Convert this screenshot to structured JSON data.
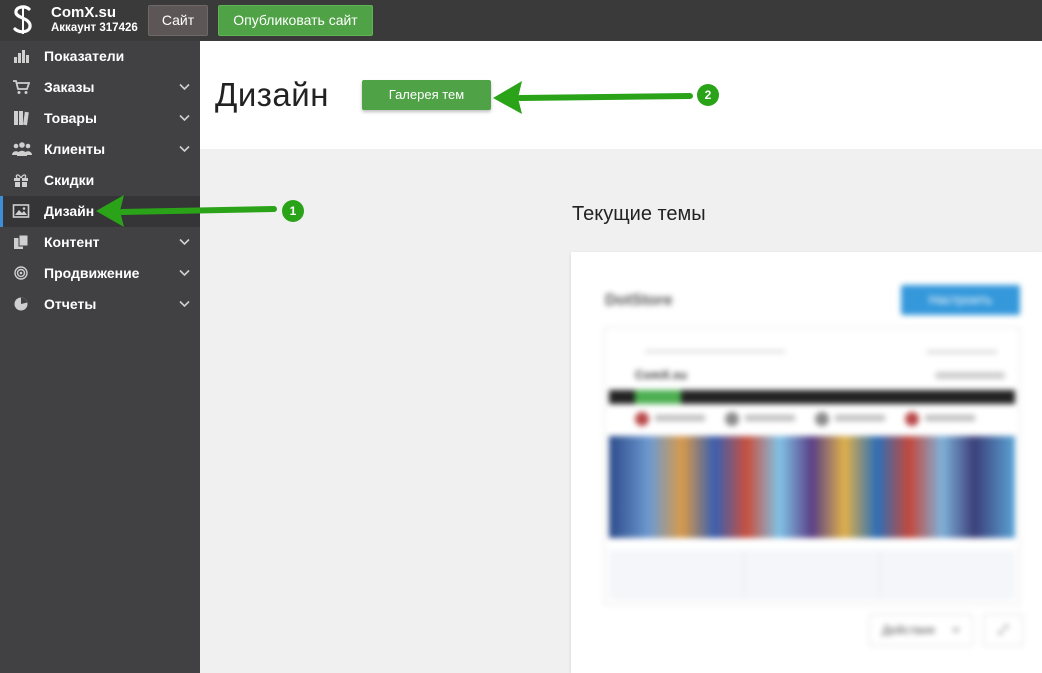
{
  "topbar": {
    "brand_name": "ComX.su",
    "account": "Аккаунт 317426",
    "site_button": "Сайт",
    "publish_button": "Опубликовать сайт"
  },
  "sidebar": {
    "items": [
      {
        "label": "Показатели",
        "icon": "bar-chart-icon",
        "has_submenu": false
      },
      {
        "label": "Заказы",
        "icon": "cart-icon",
        "has_submenu": true
      },
      {
        "label": "Товары",
        "icon": "books-icon",
        "has_submenu": true
      },
      {
        "label": "Клиенты",
        "icon": "users-icon",
        "has_submenu": true
      },
      {
        "label": "Скидки",
        "icon": "gift-icon",
        "has_submenu": false
      },
      {
        "label": "Дизайн",
        "icon": "image-icon",
        "has_submenu": false,
        "active": true
      },
      {
        "label": "Контент",
        "icon": "copy-icon",
        "has_submenu": true
      },
      {
        "label": "Продвижение",
        "icon": "target-icon",
        "has_submenu": true
      },
      {
        "label": "Отчеты",
        "icon": "pie-chart-icon",
        "has_submenu": true
      }
    ]
  },
  "main": {
    "title": "Дизайн",
    "gallery_button": "Галерея тем",
    "section_title": "Текущие темы",
    "theme_card": {
      "name": "DotStore",
      "configure_button": "Настроить",
      "actions_button": "Действия",
      "link_button": "⤢",
      "preview_logo": "ComX.su"
    }
  },
  "annotations": {
    "badge_1": "1",
    "badge_2": "2"
  },
  "colors": {
    "topbar_bg": "#3a3a3a",
    "sidebar_bg": "#414144",
    "accent_green": "#4fa246",
    "accent_blue": "#3498db",
    "arrow_green": "#2aa318"
  }
}
